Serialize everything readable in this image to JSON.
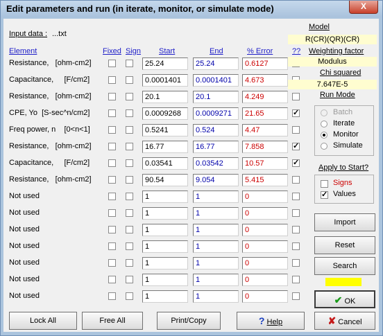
{
  "window": {
    "title": "Edit parameters and run (in iterate, monitor, or simulate mode)",
    "close_glyph": "X"
  },
  "input_data": {
    "label": "Input data :",
    "value": "...txt"
  },
  "headers": {
    "element": "Element",
    "fixed": "Fixed",
    "sign": "Sign",
    "start": "Start",
    "end": "End",
    "error": "% Error",
    "flag": "??"
  },
  "rows": [
    {
      "label": "Resistance,   [ohm-cm2]",
      "start": "25.24",
      "end": "25.24",
      "error": "0.6127",
      "flag": false
    },
    {
      "label": "Capacitance,     [F/cm2]",
      "start": "0.0001401",
      "end": "0.0001401",
      "error": "4.673",
      "flag": false
    },
    {
      "label": "Resistance,   [ohm-cm2]",
      "start": "20.1",
      "end": "20.1",
      "error": "4.249",
      "flag": false
    },
    {
      "label": "CPE, Yo  [S-sec^n/cm2]",
      "start": "0.0009268",
      "end": "0.0009271",
      "error": "21.65",
      "flag": true
    },
    {
      "label": "Freq power, n    [0<n<1]",
      "start": "0.5241",
      "end": "0.524",
      "error": "4.47",
      "flag": false
    },
    {
      "label": "Resistance,   [ohm-cm2]",
      "start": "16.77",
      "end": "16.77",
      "error": "7.858",
      "flag": true
    },
    {
      "label": "Capacitance,     [F/cm2]",
      "start": "0.03541",
      "end": "0.03542",
      "error": "10.57",
      "flag": true
    },
    {
      "label": "Resistance,   [ohm-cm2]",
      "start": "90.54",
      "end": "9.054",
      "error": "5.415",
      "flag": false
    },
    {
      "label": "Not used",
      "start": "1",
      "end": "1",
      "error": "0",
      "flag": false
    },
    {
      "label": "Not used",
      "start": "1",
      "end": "1",
      "error": "0",
      "flag": false
    },
    {
      "label": "Not used",
      "start": "1",
      "end": "1",
      "error": "0",
      "flag": false
    },
    {
      "label": "Not used",
      "start": "1",
      "end": "1",
      "error": "0",
      "flag": false
    },
    {
      "label": "Not used",
      "start": "1",
      "end": "1",
      "error": "0",
      "flag": false
    },
    {
      "label": "Not used",
      "start": "1",
      "end": "1",
      "error": "0",
      "flag": false
    },
    {
      "label": "Not used",
      "start": "1",
      "end": "1",
      "error": "0",
      "flag": false
    }
  ],
  "right": {
    "model_label": "Model",
    "model_value": "R(CR)(QR)(CR)",
    "weighting_label": "Weighting  factor",
    "weighting_value": "Modulus",
    "chi_label": "Chi squared",
    "chi_value": "7.647E-5",
    "run_mode_label": "Run Mode",
    "run_modes": [
      {
        "label": "Batch",
        "selected": false,
        "disabled": true
      },
      {
        "label": "Iterate",
        "selected": false,
        "disabled": false
      },
      {
        "label": "Monitor",
        "selected": true,
        "disabled": false
      },
      {
        "label": "Simulate",
        "selected": false,
        "disabled": false
      }
    ],
    "apply_label": "Apply to Start?",
    "signs_label": "Signs",
    "signs_checked": false,
    "values_label": "Values",
    "values_checked": true,
    "import_label": "Import",
    "reset_label": "Reset",
    "search_label": "Search",
    "ok_label": "OK",
    "cancel_label": "Cancel",
    "status_color": "#ffff00"
  },
  "bottom": {
    "lock_all": "Lock All",
    "free_all": "Free All",
    "print_copy": "Print/Copy",
    "help": "Help"
  }
}
